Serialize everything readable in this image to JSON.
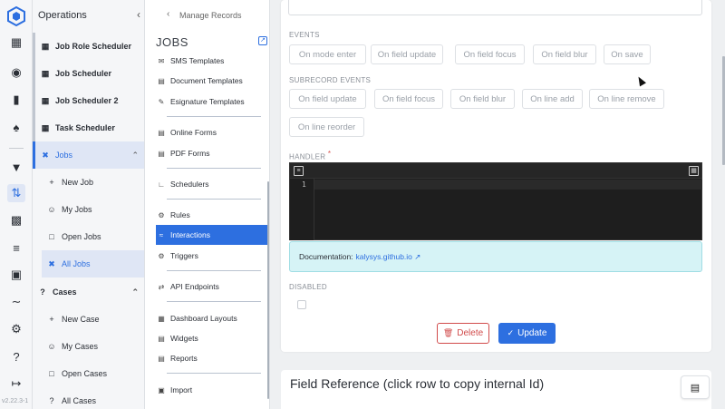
{
  "app": {
    "version": "v2.22.3-1"
  },
  "rail": {
    "icons": [
      {
        "name": "logo-icon"
      },
      {
        "name": "org-chart-icon"
      },
      {
        "name": "globe-icon"
      },
      {
        "name": "bookmark-icon"
      },
      {
        "name": "bell-icon"
      },
      {
        "name": "filter-icon"
      },
      {
        "name": "sync-icon",
        "active": true
      },
      {
        "name": "chat-icon"
      },
      {
        "name": "list-icon"
      },
      {
        "name": "inbox-icon"
      },
      {
        "name": "handshake-icon"
      },
      {
        "name": "gear-icon"
      },
      {
        "name": "help-icon"
      },
      {
        "name": "logout-icon"
      }
    ]
  },
  "sidebar": {
    "title": "Operations",
    "items": [
      {
        "label": "Job Role Scheduler"
      },
      {
        "label": "Job Scheduler"
      },
      {
        "label": "Job Scheduler 2"
      },
      {
        "label": "Task Scheduler"
      },
      {
        "label": "Jobs"
      },
      {
        "label": "New Job"
      },
      {
        "label": "My Jobs"
      },
      {
        "label": "Open Jobs"
      },
      {
        "label": "All Jobs"
      },
      {
        "label": "Cases"
      },
      {
        "label": "New Case"
      },
      {
        "label": "My Cases"
      },
      {
        "label": "Open Cases"
      },
      {
        "label": "All Cases"
      }
    ]
  },
  "menu": {
    "back_label": "Manage Records",
    "title": "JOBS",
    "items": [
      {
        "label": "SMS Templates"
      },
      {
        "label": "Document Templates"
      },
      {
        "label": "Esignature Templates"
      },
      {
        "label": "Online Forms"
      },
      {
        "label": "PDF Forms"
      },
      {
        "label": "Schedulers"
      },
      {
        "label": "Rules"
      },
      {
        "label": "Interactions"
      },
      {
        "label": "Triggers"
      },
      {
        "label": "API Endpoints"
      },
      {
        "label": "Dashboard Layouts"
      },
      {
        "label": "Widgets"
      },
      {
        "label": "Reports"
      },
      {
        "label": "Import"
      }
    ]
  },
  "main": {
    "events_label": "EVENTS",
    "events": [
      "On mode enter",
      "On field update",
      "On field focus",
      "On field blur",
      "On save"
    ],
    "subrecord_label": "SUBRECORD EVENTS",
    "subrecord_events": [
      "On field update",
      "On field focus",
      "On field blur",
      "On line add",
      "On line remove",
      "On line reorder"
    ],
    "handler_label": "HANDLER",
    "required_mark": "*",
    "line_number": "1",
    "doc_prefix": "Documentation:",
    "doc_link": "kalysys.github.io",
    "disabled_label": "DISABLED",
    "delete_label": "Delete",
    "update_label": "Update",
    "field_reference_title": "Field Reference (click row to copy internal Id)"
  },
  "colors": {
    "accent": "#2d6fe0",
    "danger": "#d14b4b",
    "info_bg": "#d6f3f6"
  }
}
